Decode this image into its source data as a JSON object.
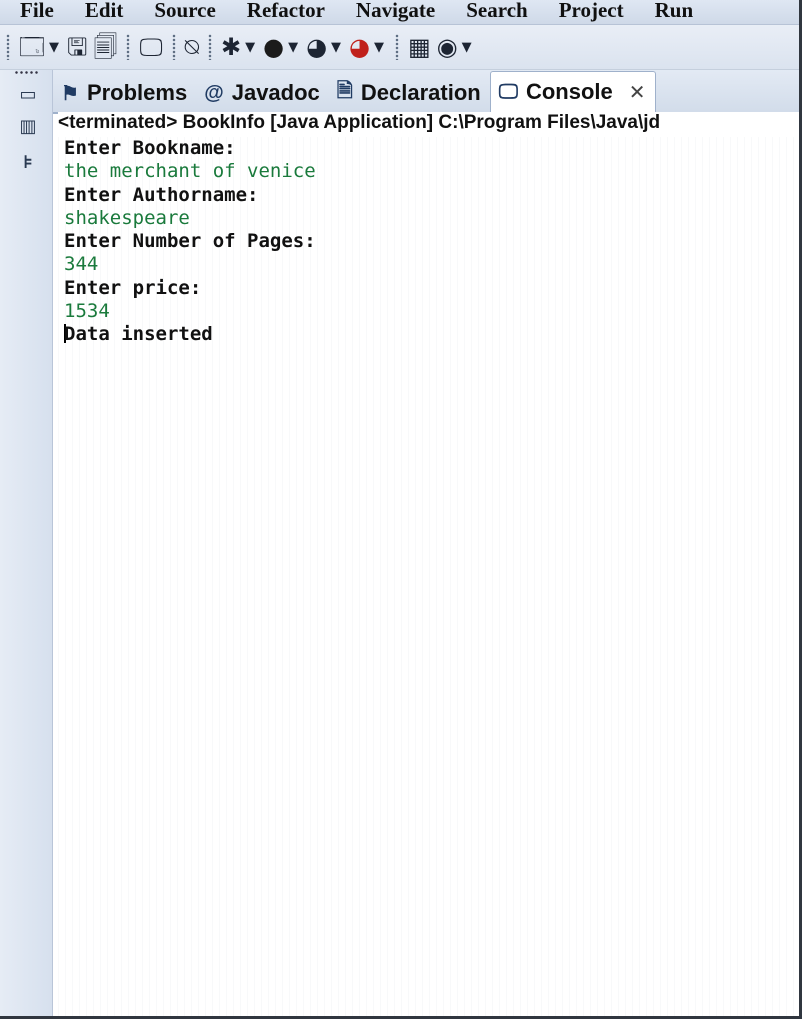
{
  "menu": [
    "File",
    "Edit",
    "Source",
    "Refactor",
    "Navigate",
    "Search",
    "Project",
    "Run"
  ],
  "tabs": [
    {
      "label": "Problems",
      "icon": "problems-icon",
      "glyph": "⚑"
    },
    {
      "label": "Javadoc",
      "icon": "at-icon",
      "glyph": "@"
    },
    {
      "label": "Declaration",
      "icon": "declaration-icon",
      "glyph": "🗎"
    },
    {
      "label": "Console",
      "icon": "console-icon",
      "glyph": "🖵",
      "active": true
    }
  ],
  "console_header": "<terminated> BookInfo [Java Application] C:\\Program Files\\Java\\jd",
  "console_lines": [
    {
      "text": "Enter Bookname:",
      "kind": "out"
    },
    {
      "text": "the merchant of venice",
      "kind": "in"
    },
    {
      "text": "Enter Authorname:",
      "kind": "out"
    },
    {
      "text": "shakespeare",
      "kind": "in"
    },
    {
      "text": "Enter Number of Pages:",
      "kind": "out"
    },
    {
      "text": "344",
      "kind": "in"
    },
    {
      "text": "Enter price:",
      "kind": "out"
    },
    {
      "text": "1534",
      "kind": "in"
    },
    {
      "text": "Data inserted",
      "kind": "out"
    }
  ],
  "colors": {
    "input_text": "#1a7a3c",
    "output_text": "#111111"
  }
}
